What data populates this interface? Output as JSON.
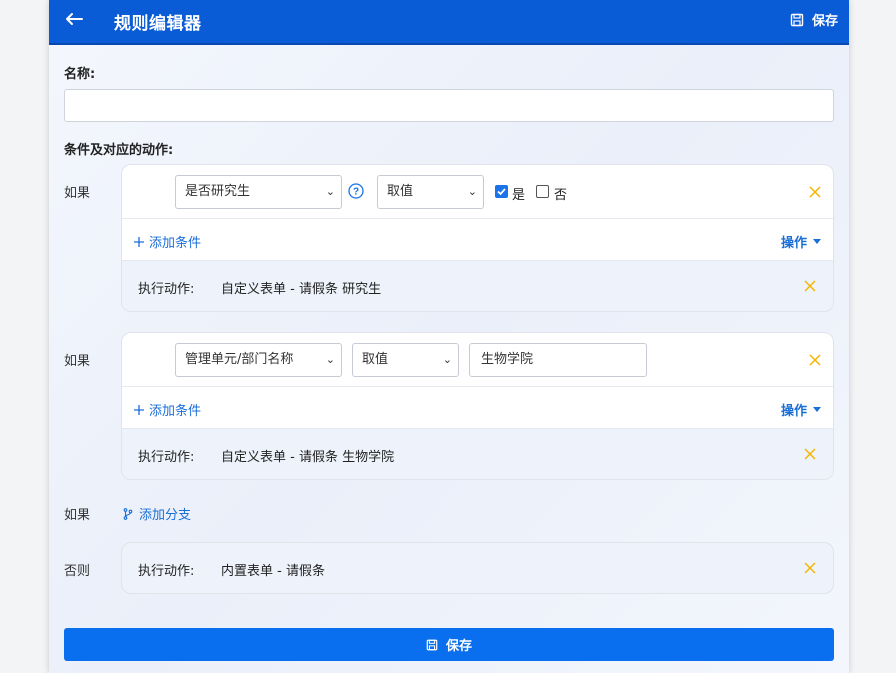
{
  "header": {
    "title": "规则编辑器",
    "save_label": "保存"
  },
  "form": {
    "name_label": "名称:",
    "name_value": "",
    "conditions_label": "条件及对应的动作:"
  },
  "branches": [
    {
      "row_label": "如果",
      "field": "是否研究生",
      "operator": "取值",
      "checkboxes": [
        {
          "label": "是",
          "checked": true
        },
        {
          "label": "否",
          "checked": false
        }
      ],
      "add_condition": "添加条件",
      "ops_label": "操作",
      "action_label": "执行动作:",
      "action_value": "自定义表单 - 请假条 研究生"
    },
    {
      "row_label": "如果",
      "field": "管理单元/部门名称",
      "operator": "取值",
      "value": "生物学院",
      "add_condition": "添加条件",
      "ops_label": "操作",
      "action_label": "执行动作:",
      "action_value": "自定义表单 - 请假条 生物学院"
    }
  ],
  "add_branch": {
    "row_label": "如果",
    "label": "添加分支"
  },
  "else_branch": {
    "row_label": "否则",
    "action_label": "执行动作:",
    "action_value": "内置表单 - 请假条"
  },
  "footer": {
    "save_label": "保存"
  },
  "colors": {
    "header_bg": "#0a5bd6",
    "primary": "#0a6fee",
    "link": "#1a6ed8",
    "delete_x": "#f5b400",
    "action_bg": "#eef3fb"
  },
  "icons": [
    "arrow-left-icon",
    "save-icon",
    "question-circle-icon",
    "close-icon",
    "plus-icon",
    "caret-down-icon",
    "branch-icon"
  ]
}
